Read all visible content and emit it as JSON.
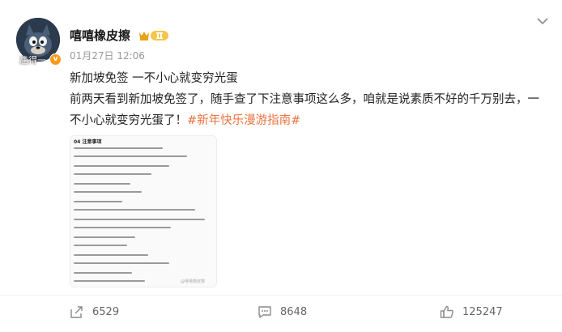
{
  "user": {
    "name": "嘻嘻橡皮擦",
    "avatar_caption": "尴得一",
    "verified_badge": "v",
    "level_badge_icon": "crown-level-icon"
  },
  "post": {
    "timestamp": "01月27日 12:06",
    "line1": "新加坡免签 一不小心就变穷光蛋",
    "line2": "前两天看到新加坡免签了，随手查了下注意事项这么多，咱就是说素质不好的千万别去，一不小心就变穷光蛋了！",
    "hashtag": "#新年快乐漫游指南#"
  },
  "image": {
    "title": "04 注意事项",
    "watermark": "@嘻嘻橡皮擦"
  },
  "actions": {
    "share_count": "6529",
    "comment_count": "8648",
    "like_count": "125247"
  },
  "colors": {
    "hashtag": "#eb7340",
    "verified": "#f99a1a",
    "muted": "#999999"
  }
}
